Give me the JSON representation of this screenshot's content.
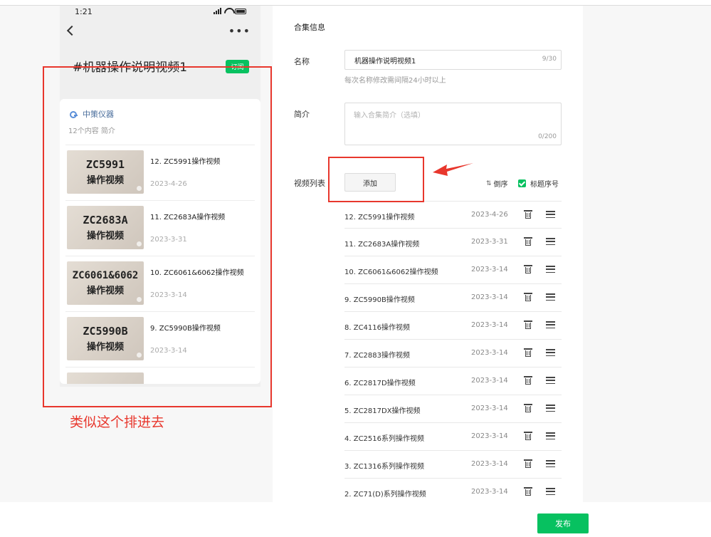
{
  "phone": {
    "time": "1:21",
    "collection_title": "#机器操作说明视频1",
    "subscribe_label": "订阅",
    "channel_name": "中策仪器",
    "channel_meta": "12个内容  简介",
    "items": [
      {
        "code": "ZC5991",
        "sub": "操作视频",
        "title": "12. ZC5991操作视频",
        "date": "2023-4-26"
      },
      {
        "code": "ZC2683A",
        "sub": "操作视频",
        "title": "11. ZC2683A操作视频",
        "date": "2023-3-31"
      },
      {
        "code": "ZC6061&6062",
        "sub": "操作视频",
        "title": "10. ZC6061&6062操作视频",
        "date": "2023-3-14"
      },
      {
        "code": "ZC5990B",
        "sub": "操作视频",
        "title": "9. ZC5990B操作视频",
        "date": "2023-3-14"
      },
      {
        "code": "",
        "sub": "",
        "title": "",
        "date": ""
      }
    ]
  },
  "annotation": {
    "note": "类似这个排进去",
    "color": "#e8372d"
  },
  "form": {
    "section_title": "合集信息",
    "name_label": "名称",
    "name_value": "机器操作说明视频1",
    "name_count": "9/30",
    "name_hint": "每次名称修改需间隔24小时以上",
    "desc_label": "简介",
    "desc_placeholder": "输入合集简介（选填）",
    "desc_count": "0/200",
    "video_list_label": "视频列表",
    "add_label": "添加",
    "reverse_label": "倒序",
    "title_number_label": "标题序号"
  },
  "videos": [
    {
      "title": "12. ZC5991操作视频",
      "date": "2023-4-26"
    },
    {
      "title": "11. ZC2683A操作视频",
      "date": "2023-3-31"
    },
    {
      "title": "10. ZC6061&6062操作视频",
      "date": "2023-3-14"
    },
    {
      "title": "9. ZC5990B操作视频",
      "date": "2023-3-14"
    },
    {
      "title": "8. ZC4116操作视频",
      "date": "2023-3-14"
    },
    {
      "title": "7. ZC2883操作视频",
      "date": "2023-3-14"
    },
    {
      "title": "6. ZC2817D操作视频",
      "date": "2023-3-14"
    },
    {
      "title": "5. ZC2817DX操作视频",
      "date": "2023-3-14"
    },
    {
      "title": "4. ZC2516系列操作视频",
      "date": "2023-3-14"
    },
    {
      "title": "3. ZC1316系列操作视频",
      "date": "2023-3-14"
    },
    {
      "title": "2. ZC71(D)系列操作视频",
      "date": "2023-3-14"
    }
  ],
  "footer": {
    "publish_label": "发布",
    "accent_color": "#07c160"
  }
}
